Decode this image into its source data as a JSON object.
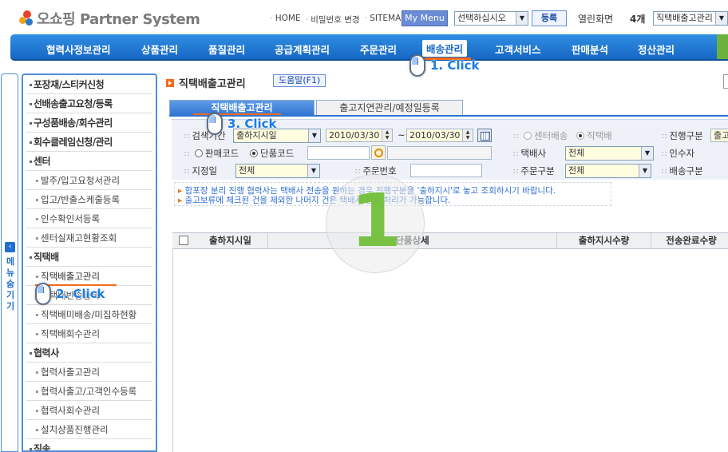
{
  "header": {
    "logo_text": "오쇼핑 Partner System",
    "links": [
      "HOME",
      "비밀번호 변경",
      "SITEMAP"
    ],
    "my_menu_label": "My Menu",
    "menu_select_value": "선택하십시오",
    "register_label": "등록",
    "open_screens_label": "열린화면",
    "open_screens_count": "4개",
    "open_screen_select_value": "직택배출고관리"
  },
  "nav": {
    "items": [
      "협력사정보관리",
      "상품관리",
      "품질관리",
      "공급계획관리",
      "주문관리",
      "배송관리",
      "고객서비스",
      "판매분석",
      "정산관리"
    ],
    "active": "배송관리"
  },
  "sidebar_tab": {
    "label": "메뉴숨기기"
  },
  "left_menu": {
    "items": [
      {
        "label": "포장재/스티커신청",
        "type": "cat"
      },
      {
        "label": "선배송출고요청/등록",
        "type": "cat"
      },
      {
        "label": "구성품배송/회수관리",
        "type": "cat"
      },
      {
        "label": "회수클레임신청/관리",
        "type": "cat"
      },
      {
        "label": "센터",
        "type": "cat"
      },
      {
        "label": "발주/입고요청서관리",
        "type": "sub"
      },
      {
        "label": "입고/반출스케줄등록",
        "type": "sub"
      },
      {
        "label": "인수확인서등록",
        "type": "sub"
      },
      {
        "label": "센터실재고현황조회",
        "type": "sub"
      },
      {
        "label": "직택배",
        "type": "cat"
      },
      {
        "label": "직택배출고관리",
        "type": "sub"
      },
      {
        "label": "직택배반송등록",
        "type": "sub"
      },
      {
        "label": "직택배미배송/미집하현황",
        "type": "sub"
      },
      {
        "label": "직택배회수관리",
        "type": "sub"
      },
      {
        "label": "협력사",
        "type": "cat"
      },
      {
        "label": "협력사출고관리",
        "type": "sub"
      },
      {
        "label": "협력사출고/고객인수등록",
        "type": "sub"
      },
      {
        "label": "협력사회수관리",
        "type": "sub"
      },
      {
        "label": "설치상품진행관리",
        "type": "sub"
      },
      {
        "label": "직송",
        "type": "cat"
      }
    ]
  },
  "page": {
    "title": "직택배출고관리",
    "help_label": "도움말(F1)",
    "tabs": [
      "직택배출고관리",
      "출고지연관리/예정일등록"
    ]
  },
  "search": {
    "period_label": "검색기간",
    "period_type_value": "출하지시일",
    "date_from": "2010/03/30",
    "date_sep": "~",
    "date_to": "2010/03/30",
    "center_radio": "센터배송",
    "direct_radio": "직택배",
    "status_label": "진행구분",
    "status_value": "출고",
    "sale_code_radio": "판매코드",
    "item_code_radio": "단품코드",
    "courier_label": "택배사",
    "courier_value": "전체",
    "receiver_label": "인수자",
    "store_label": "지정일",
    "store_value": "전체",
    "order_no_label": "주문번호",
    "order_type_label": "주문구분",
    "order_type_value": "전체",
    "delivery_type_label": "배송구분"
  },
  "notices": [
    "합포장 분리 진행 협력사는 택배사 전송을 원하는 경우 진행구분을 '출하지시'로 놓고 조회하시기 바랍니다.",
    "출고보류에 체크된 건을 제외한 나머지 건은 택배사 전송 처리가 가능합니다."
  ],
  "grid": {
    "columns": [
      "출하지시일",
      "단품상세",
      "출하지시수량",
      "전송완료수량"
    ]
  },
  "tutorial": {
    "step_number": "1",
    "clicks": [
      "1. Click",
      "2. Click",
      "3. Click"
    ]
  }
}
